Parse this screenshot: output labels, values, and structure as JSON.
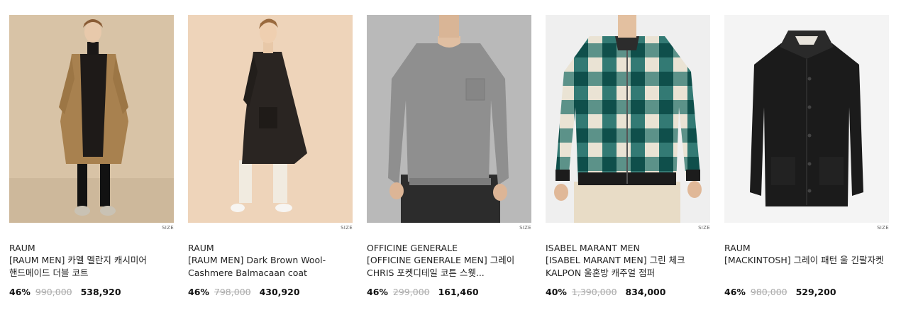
{
  "products": [
    {
      "brand": "RAUM",
      "title": "[RAUM MEN] 카멜 멜란지 캐시미어 핸드메이드 더블 코트",
      "discount": "46%",
      "original_price": "990,000",
      "sale_price": "538,920",
      "size_tag": "SIZE",
      "image_bg": "#d9c4a8"
    },
    {
      "brand": "RAUM",
      "title": "[RAUM MEN] Dark Brown Wool-Cashmere Balmacaan coat",
      "discount": "46%",
      "original_price": "798,000",
      "sale_price": "430,920",
      "size_tag": "SIZE",
      "image_bg": "#efd6bd"
    },
    {
      "brand": "OFFICINE GENERALE",
      "title": "[OFFICINE GENERALE MEN] 그레이 CHRIS 포켓디테일 코튼 스웻...",
      "discount": "46%",
      "original_price": "299,000",
      "sale_price": "161,460",
      "size_tag": "SIZE",
      "image_bg": "#b8b8b8"
    },
    {
      "brand": "ISABEL MARANT MEN",
      "title": "[ISABEL MARANT MEN] 그린 체크 KALPON 울혼방 캐주얼 점퍼",
      "discount": "40%",
      "original_price": "1,390,000",
      "sale_price": "834,000",
      "size_tag": "SIZE",
      "image_bg": "#efefef"
    },
    {
      "brand": "RAUM",
      "title": "[MACKINTOSH] 그레이 패턴 울 긴팔자켓",
      "discount": "46%",
      "original_price": "980,000",
      "sale_price": "529,200",
      "size_tag": "SIZE",
      "image_bg": "#f4f4f4"
    }
  ]
}
